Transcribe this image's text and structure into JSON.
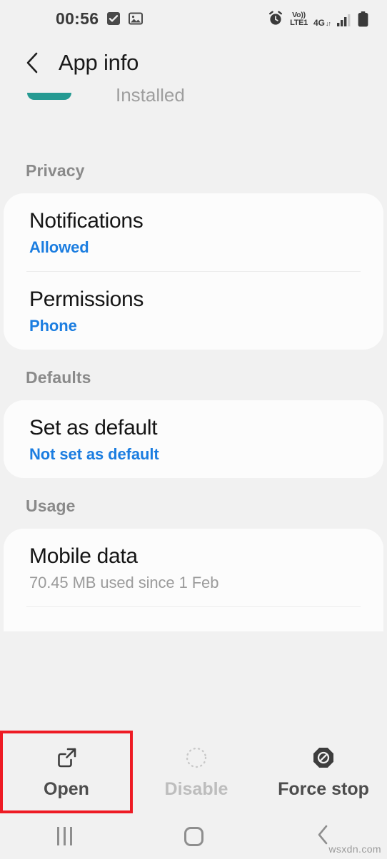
{
  "status_bar": {
    "time": "00:56",
    "icons": [
      "checkbox-checked-icon",
      "photo-icon"
    ],
    "right_icons": [
      "alarm-icon",
      "volte-icon",
      "mobile-data-4g-icon",
      "signal-bars-icon",
      "battery-icon"
    ],
    "volte_line1": "Vo))",
    "volte_line2": "LTE1",
    "network_label": "4G",
    "network_arrows": "↓↑"
  },
  "header": {
    "back_icon": "back-chevron-icon",
    "title": "App info"
  },
  "app_summary": {
    "status": "Installed"
  },
  "sections": [
    {
      "title": "Privacy",
      "rows": [
        {
          "title": "Notifications",
          "subtitle": "Allowed",
          "subtitle_style": "blue"
        },
        {
          "title": "Permissions",
          "subtitle": "Phone",
          "subtitle_style": "blue"
        }
      ]
    },
    {
      "title": "Defaults",
      "rows": [
        {
          "title": "Set as default",
          "subtitle": "Not set as default",
          "subtitle_style": "blue"
        }
      ]
    },
    {
      "title": "Usage",
      "rows": [
        {
          "title": "Mobile data",
          "subtitle": "70.45 MB used since 1 Feb",
          "subtitle_style": "gray"
        }
      ]
    }
  ],
  "actions": [
    {
      "label": "Open",
      "icon": "open-external-icon",
      "enabled": true,
      "highlighted": true
    },
    {
      "label": "Disable",
      "icon": "dotted-circle-icon",
      "enabled": false,
      "highlighted": false
    },
    {
      "label": "Force stop",
      "icon": "force-stop-octagon-icon",
      "enabled": true,
      "highlighted": false
    }
  ],
  "nav_bar": {
    "recents": "recents-icon",
    "home": "home-icon",
    "back": "back-icon"
  },
  "watermark": "wsxdn.com",
  "colors": {
    "background": "#f1f1f1",
    "card": "#fcfcfc",
    "accent_blue": "#1b7de0",
    "highlight_red": "#ee1b24",
    "app_icon_teal": "#259a92",
    "section_header_gray": "#8a8a8a"
  }
}
